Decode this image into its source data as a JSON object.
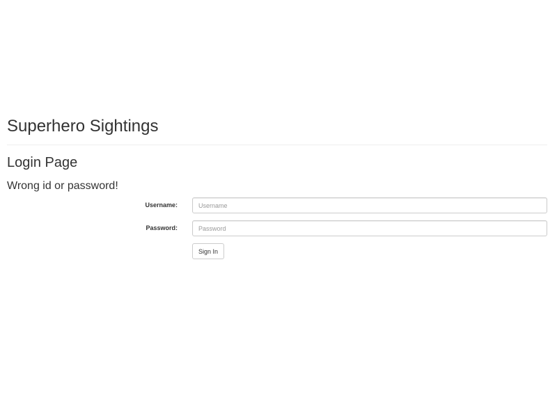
{
  "header": {
    "site_title": "Superhero Sightings"
  },
  "main": {
    "page_heading": "Login Page",
    "error_message": "Wrong id or password!"
  },
  "login_form": {
    "username_label": "Username:",
    "username_placeholder": "Username",
    "username_value": "",
    "password_label": "Password:",
    "password_placeholder": "Password",
    "password_value": "",
    "submit_label": "Sign In"
  }
}
